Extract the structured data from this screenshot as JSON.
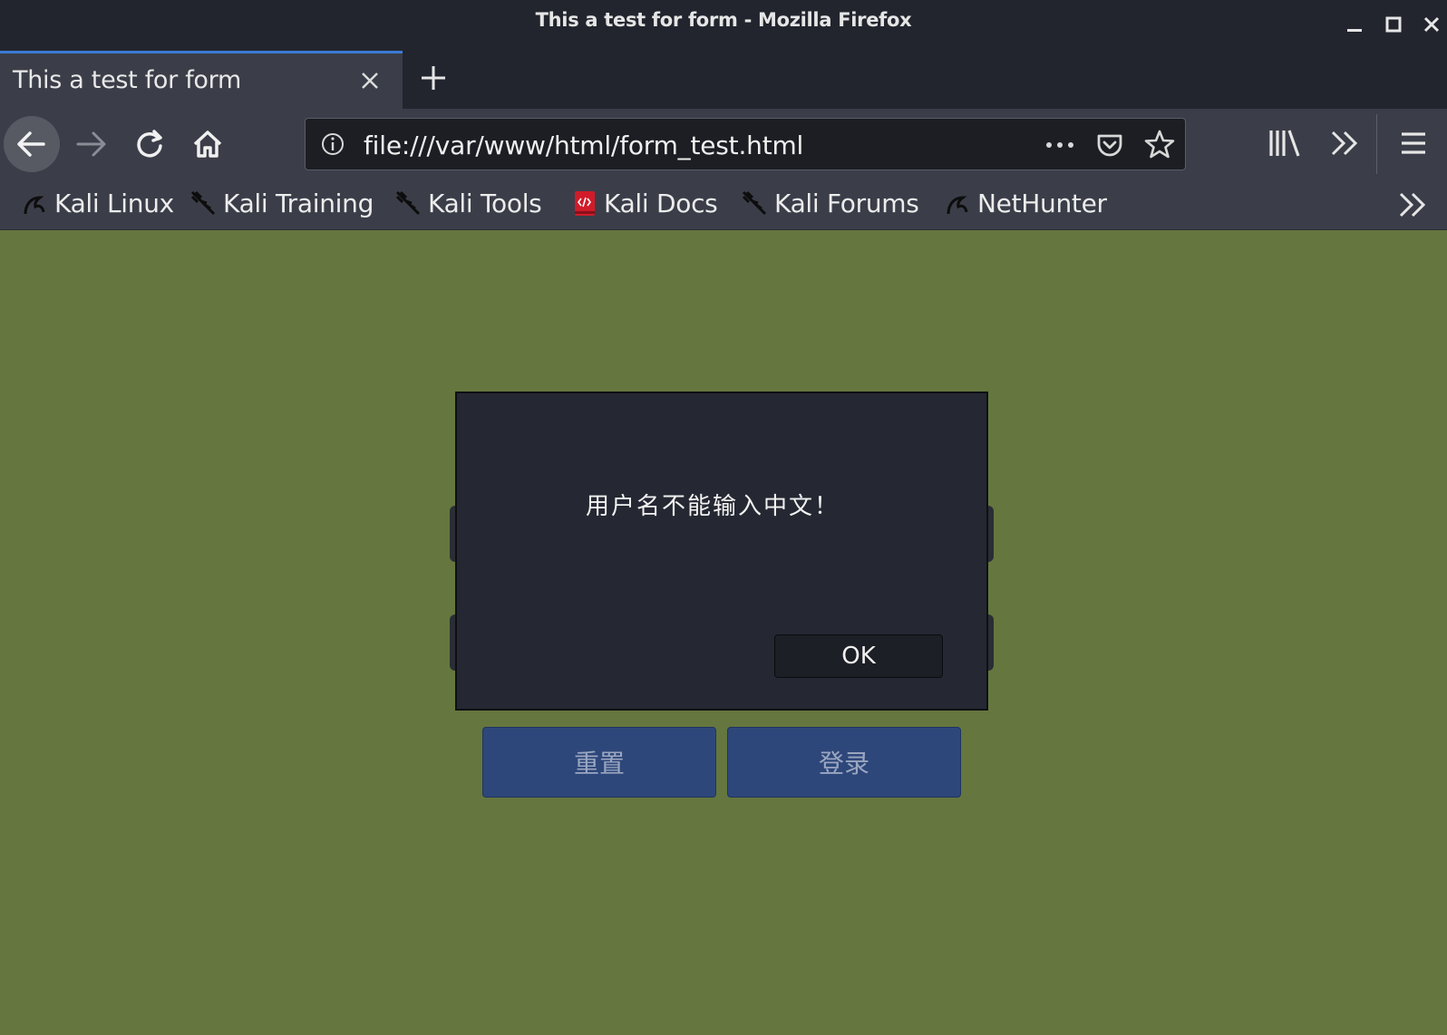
{
  "window": {
    "title": "This a test for form - Mozilla Firefox",
    "controls": [
      "minimize-icon",
      "maximize-icon",
      "close-icon"
    ]
  },
  "tabs": [
    {
      "label": "This a test for form",
      "active": true
    }
  ],
  "navbar": {
    "url": "file:///var/www/html/form_test.html",
    "icons": [
      "back-arrow-icon",
      "forward-arrow-icon",
      "reload-icon",
      "home-icon",
      "info-icon",
      "more-actions-icon",
      "pocket-icon",
      "bookmark-star-icon",
      "library-icon",
      "overflow-chevron-icon",
      "hamburger-menu-icon"
    ]
  },
  "bookmarks": [
    {
      "label": "Kali Linux",
      "icon": "kali-dragon-icon"
    },
    {
      "label": "Kali Training",
      "icon": "kali-feather-icon"
    },
    {
      "label": "Kali Tools",
      "icon": "kali-feather-icon"
    },
    {
      "label": "Kali Docs",
      "icon": "kali-docs-icon"
    },
    {
      "label": "Kali Forums",
      "icon": "kali-feather-icon"
    },
    {
      "label": "NetHunter",
      "icon": "kali-dragon-icon"
    }
  ],
  "page": {
    "background": "#65763e",
    "buttons": {
      "reset": "重置",
      "login": "登录"
    }
  },
  "dialog": {
    "message": "用户名不能输入中文！",
    "ok_label": "OK"
  },
  "colors": {
    "chrome_dark": "#22252e",
    "chrome_toolbar": "#3b3e49",
    "tab_accent": "#3a7bd5",
    "form_button": "#2e477a",
    "dialog_bg": "#252832"
  }
}
